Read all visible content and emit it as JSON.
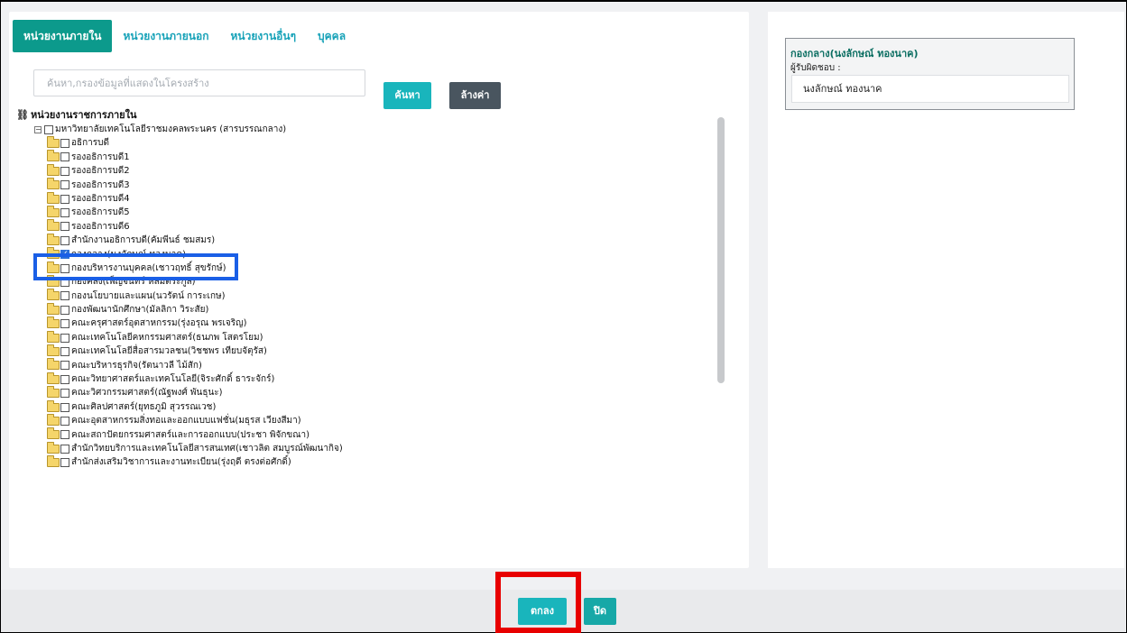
{
  "tabs": [
    {
      "label": "หน่วยงานภายใน",
      "active": true
    },
    {
      "label": "หน่วยงานภายนอก",
      "active": false
    },
    {
      "label": "หน่วยงานอื่นๆ",
      "active": false
    },
    {
      "label": "บุคคล",
      "active": false
    }
  ],
  "search": {
    "placeholder": "ค้นหา,กรองข้อมูลที่แสดงในโครงสร้าง",
    "search_label": "ค้นหา",
    "clear_label": "ล้างค่า"
  },
  "tree": {
    "root_label": "หน่วยงานราชการภายใน",
    "org_label": "มหาวิทยาลัยเทคโนโลยีราชมงคลพระนคร (สารบรรณกลาง)",
    "items": [
      {
        "label": "อธิการบดี",
        "checked": false
      },
      {
        "label": "รองอธิการบดี1",
        "checked": false
      },
      {
        "label": "รองอธิการบดี2",
        "checked": false
      },
      {
        "label": "รองอธิการบดี3",
        "checked": false
      },
      {
        "label": "รองอธิการบดี4",
        "checked": false
      },
      {
        "label": "รองอธิการบดี5",
        "checked": false
      },
      {
        "label": "รองอธิการบดี6",
        "checked": false
      },
      {
        "label": "สำนักงานอธิการบดี(คัมพีนธ์ ชมสมร)",
        "checked": false
      },
      {
        "label": "กองกลาง(นงลักษณ์ ทองนาค)",
        "checked": true
      },
      {
        "label": "กองบริหารงานบุคคล(เชาวฤทธิ์ สุขรักษ์)",
        "checked": false
      },
      {
        "label": "กองคลัง(เพ็ญจันทร์ หลิมตระกูล)",
        "checked": false
      },
      {
        "label": "กองนโยบายและแผน(นวรัตน์ การะเกษ)",
        "checked": false
      },
      {
        "label": "กองพัฒนานักศึกษา(มัลลิกา วิระสัย)",
        "checked": false
      },
      {
        "label": "คณะครุศาสตร์อุตสาหกรรม(รุ่งอรุณ พรเจริญ)",
        "checked": false
      },
      {
        "label": "คณะเทคโนโลยีคหกรรมศาสตร์(ธนภพ โสตรโยม)",
        "checked": false
      },
      {
        "label": "คณะเทคโนโลยีสื่อสารมวลชน(วิชชพร เทียบจัตุรัส)",
        "checked": false
      },
      {
        "label": "คณะบริหารธุรกิจ(รัตนาวลี ไม้สัก)",
        "checked": false
      },
      {
        "label": "คณะวิทยาศาสตร์และเทคโนโลยี(จิระศักดิ์ ธาระจักร์)",
        "checked": false
      },
      {
        "label": "คณะวิศวกรรมศาสตร์(ณัฐพงศ์ พันธุนะ)",
        "checked": false
      },
      {
        "label": "คณะศิลปศาสตร์(ยุทธภูมิ สุวรรณเวช)",
        "checked": false
      },
      {
        "label": "คณะอุตสาหกรรมสิ่งทอและออกแบบแฟชั่น(มธุรส เวียงสีมา)",
        "checked": false
      },
      {
        "label": "คณะสถาปัตยกรรมศาสตร์และการออกแบบ(ประชา พิจักขณา)",
        "checked": false
      },
      {
        "label": "สำนักวิทยบริการและเทคโนโลยีสารสนเทศ(เชาวลิต สมบูรณ์พัฒนากิจ)",
        "checked": false
      },
      {
        "label": "สำนักส่งเสริมวิชาการและงานทะเบียน(รุ่งฤดี ตรงต่อศักดิ์)",
        "checked": false
      }
    ]
  },
  "selected": {
    "title": "กองกลาง(นงลักษณ์ ทองนาค)",
    "responsible_label": "ผู้รับผิดชอบ :",
    "responsible_value": "นงลักษณ์ ทองนาค"
  },
  "footer": {
    "ok_label": "ตกลง",
    "close_label": "ปิด"
  },
  "colors": {
    "accent": "#19b5bc",
    "active_tab": "#0c9a8c",
    "highlight_blue": "#1a5fe6",
    "highlight_red": "#e80000"
  }
}
